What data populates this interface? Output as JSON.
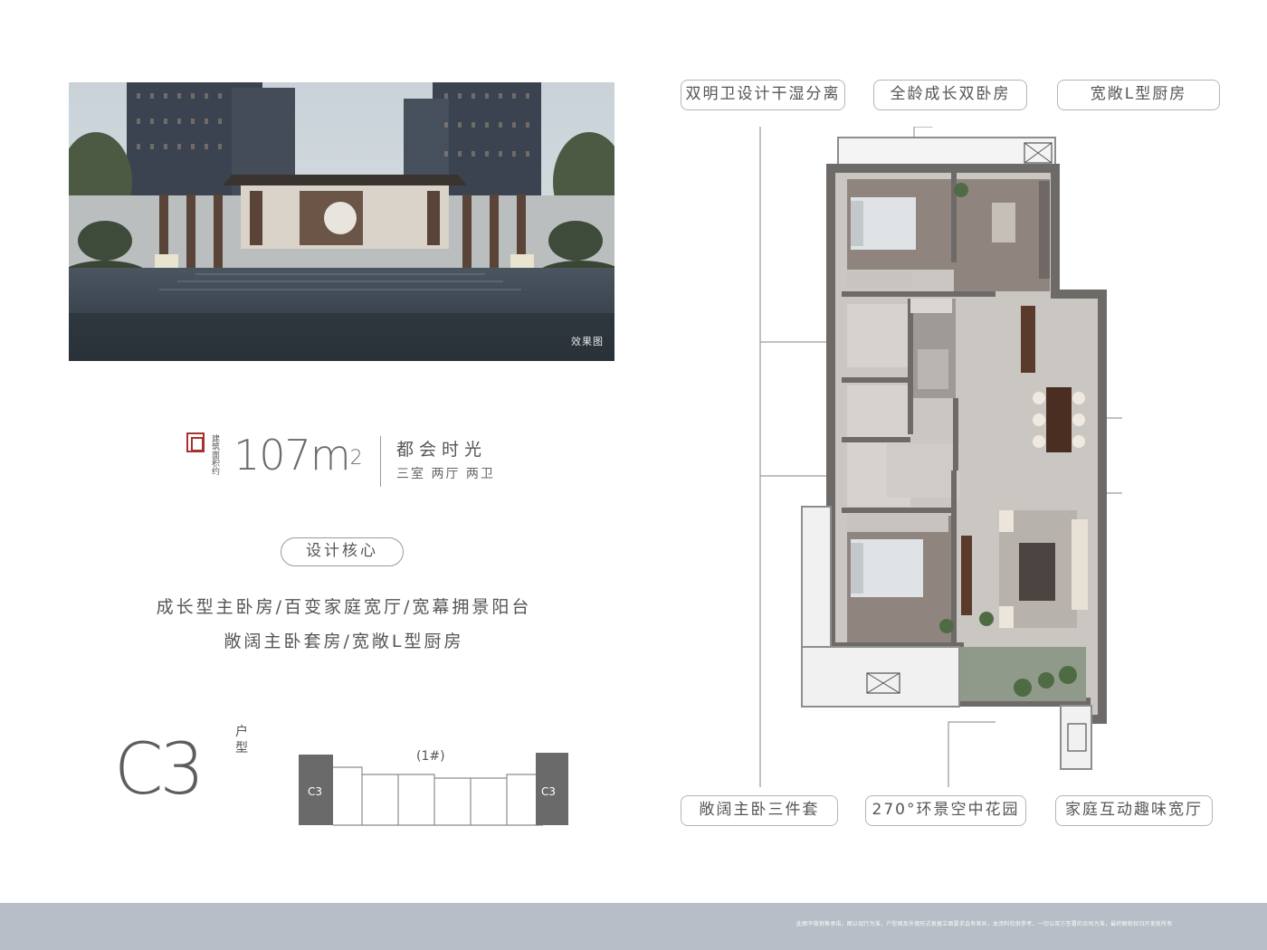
{
  "render": {
    "caption": "效果图"
  },
  "unit": {
    "area_caption": "建筑面积约",
    "area_value": "107",
    "area_unit": "m",
    "area_unit_exp": "2",
    "project_name": "都会时光",
    "layout": "三室 两厅 两卫",
    "type_code": "C3",
    "type_word": "户型"
  },
  "design_core": {
    "heading": "设计核心",
    "lines": [
      "成长型主卧房/百变家庭宽厅/宽幕拥景阳台",
      "敞阔主卧套房/宽敞L型厨房"
    ]
  },
  "keyplan": {
    "building": "(1#)",
    "unit_left": "C3",
    "unit_right": "C3"
  },
  "features": {
    "top": [
      "双明卫设计干湿分离",
      "全龄成长双卧房",
      "宽敞L型厨房"
    ],
    "bottom": [
      "敞阔主卧三件套",
      "270°环景空中花园",
      "家庭互动趣味宽厅"
    ]
  },
  "colors": {
    "wall": "#6e6a68",
    "floor": "#c9c6c2",
    "wood": "#5a3a2a",
    "footer": "#b8bec7",
    "seal": "#a8322d"
  },
  "footer": {
    "disclaimer": "此图不做销售承诺，图以现行为准，户型图及外墙形式根据立面要求会有差异，本资料仅供参考，一切以双方签署的合同为准，最终解释权归开发商所有"
  }
}
